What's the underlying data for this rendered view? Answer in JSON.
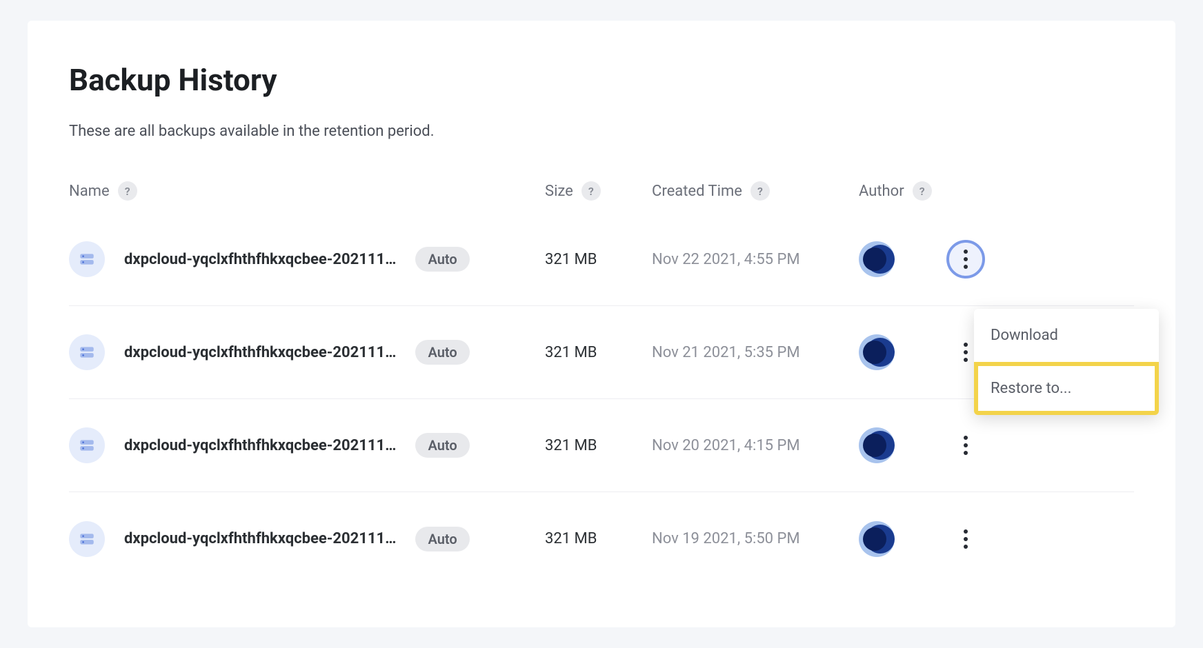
{
  "page": {
    "title": "Backup History",
    "subtitle": "These are all backups available in the retention period."
  },
  "columns": {
    "name": "Name",
    "size": "Size",
    "created": "Created Time",
    "author": "Author"
  },
  "rows": [
    {
      "name": "dxpcloud-yqclxfhthfhkxqcbee-202111…",
      "badge": "Auto",
      "size": "321 MB",
      "created": "Nov 22 2021, 4:55 PM",
      "menu_open": true
    },
    {
      "name": "dxpcloud-yqclxfhthfhkxqcbee-202111…",
      "badge": "Auto",
      "size": "321 MB",
      "created": "Nov 21 2021, 5:35 PM",
      "menu_open": false
    },
    {
      "name": "dxpcloud-yqclxfhthfhkxqcbee-202111…",
      "badge": "Auto",
      "size": "321 MB",
      "created": "Nov 20 2021, 4:15 PM",
      "menu_open": false
    },
    {
      "name": "dxpcloud-yqclxfhthfhkxqcbee-202111…",
      "badge": "Auto",
      "size": "321 MB",
      "created": "Nov 19 2021, 5:50 PM",
      "menu_open": false
    }
  ],
  "dropdown": {
    "download": "Download",
    "restore": "Restore to..."
  }
}
